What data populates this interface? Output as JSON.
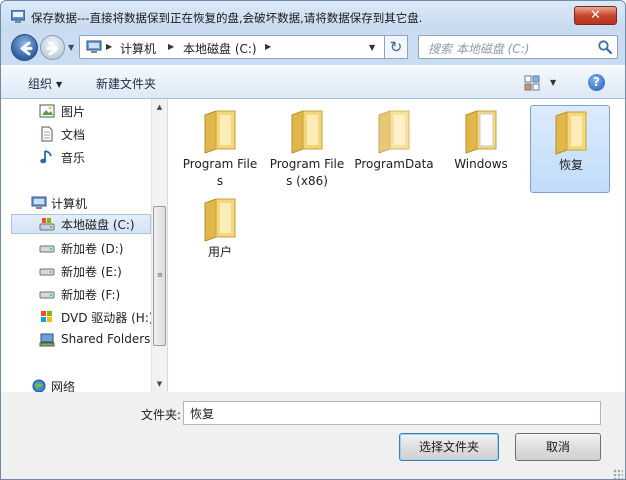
{
  "window": {
    "title": "保存数据---直接将数据保到正在恢复的盘,会破坏数据,请将数据保存到其它盘.",
    "close_label": "✕"
  },
  "address": {
    "crumbs": [
      "计算机",
      "本地磁盘 (C:)"
    ],
    "refresh_symbol": "↻"
  },
  "search": {
    "placeholder": "搜索 本地磁盘 (C:)"
  },
  "toolbar": {
    "organize_label": "组织",
    "new_folder_label": "新建文件夹",
    "help_label": "?"
  },
  "nav": {
    "libraries": [
      {
        "label": "图片",
        "icon": "pictures-icon"
      },
      {
        "label": "文档",
        "icon": "documents-icon"
      },
      {
        "label": "音乐",
        "icon": "music-icon"
      }
    ],
    "computer_label": "计算机",
    "drives": [
      {
        "label": "本地磁盘 (C:)",
        "icon": "local-disk-icon",
        "selected": true
      },
      {
        "label": "新加卷 (D:)",
        "icon": "drive-icon"
      },
      {
        "label": "新加卷 (E:)",
        "icon": "drive-icon"
      },
      {
        "label": "新加卷 (F:)",
        "icon": "drive-icon"
      },
      {
        "label": "DVD 驱动器 (H:)",
        "icon": "dvd-drive-icon"
      },
      {
        "label": "Shared Folders",
        "icon": "shared-folders-icon"
      }
    ],
    "network_label": "网络"
  },
  "folders": [
    {
      "label": "Program Files"
    },
    {
      "label": "Program Files (x86)"
    },
    {
      "label": "ProgramData"
    },
    {
      "label": "Windows"
    },
    {
      "label": "恢复",
      "selected": true
    },
    {
      "label": "用户"
    }
  ],
  "footer": {
    "folder_label": "文件夹:",
    "folder_value": "恢复",
    "select_button": "选择文件夹",
    "cancel_button": "取消"
  },
  "colors": {
    "chrome": "#c9dcf2",
    "folder": "#f0cf6a",
    "selection": "#c1dcfa",
    "close": "#c8452d"
  }
}
